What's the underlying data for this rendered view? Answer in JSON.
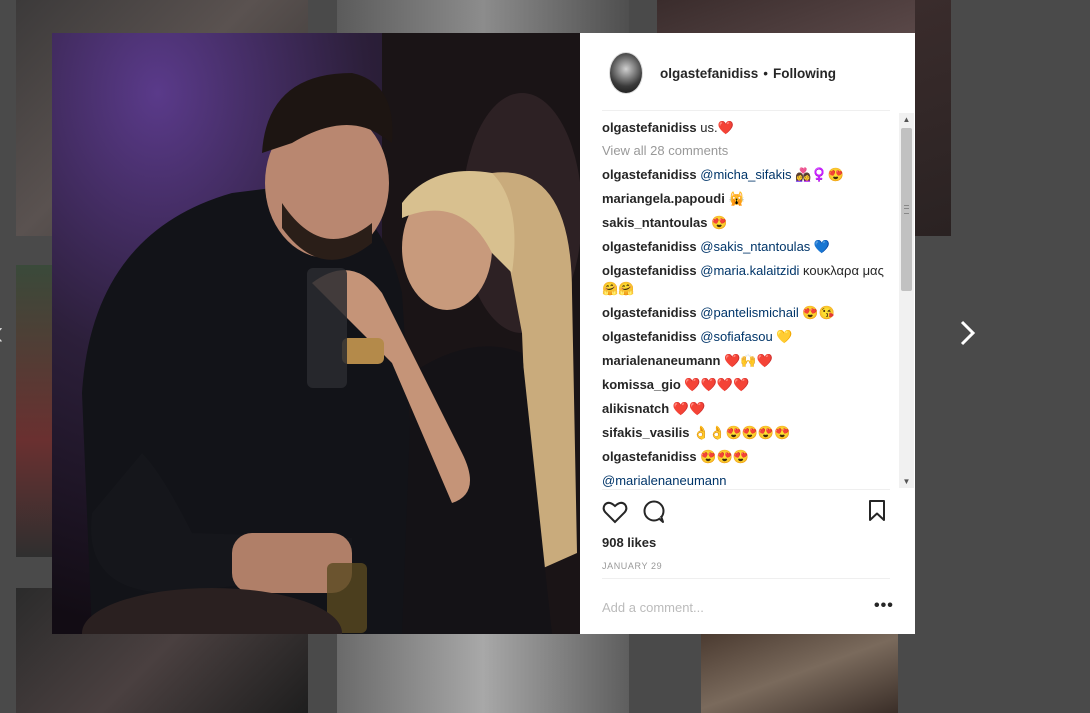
{
  "post": {
    "username": "olgastefanidiss",
    "separator": "•",
    "follow_status": "Following",
    "caption": {
      "user": "olgastefanidiss",
      "text": "us.❤️"
    },
    "view_all": "View all 28 comments",
    "likes": "908 likes",
    "date": "JANUARY 29",
    "add_comment_placeholder": "Add a comment...",
    "more_label": "•••"
  },
  "comments": [
    {
      "user": "olgastefanidiss",
      "mention": "@micha_sifakis",
      "text": " 👩‍❤️‍👩♀️😍"
    },
    {
      "user": "mariangela.papoudi",
      "mention": "",
      "text": " 🙀"
    },
    {
      "user": "sakis_ntantoulas",
      "mention": "",
      "text": " 😍"
    },
    {
      "user": "olgastefanidiss",
      "mention": "@sakis_ntantoulas",
      "text": " 💙"
    },
    {
      "user": "olgastefanidiss",
      "mention": "@maria.kalaitzidi",
      "text": " κουκλαρα μας🤗🤗"
    },
    {
      "user": "olgastefanidiss",
      "mention": "@pantelismichail",
      "text": " 😍😘"
    },
    {
      "user": "olgastefanidiss",
      "mention": "@sofiafasou",
      "text": " 💛"
    },
    {
      "user": "marialenaneumann",
      "mention": "",
      "text": " ❤️🙌❤️"
    },
    {
      "user": "komissa_gio",
      "mention": "",
      "text": " ❤️❤️❤️❤️"
    },
    {
      "user": "alikisnatch",
      "mention": "",
      "text": " ❤️❤️"
    },
    {
      "user": "sifakis_vasilis",
      "mention": "",
      "text": " 👌👌😍😍😍😍"
    },
    {
      "user": "olgastefanidiss",
      "mention": "",
      "text": " 😍😍😍"
    },
    {
      "user": "",
      "mention": "@marialenaneumann",
      "text": ""
    }
  ],
  "icons": {
    "nav_prev": "chevron-left",
    "nav_next": "chevron-right",
    "like": "heart-outline",
    "comment": "speech-bubble",
    "save": "bookmark-outline"
  },
  "colors": {
    "text": "#262626",
    "mention": "#003569",
    "muted": "#999999",
    "backdrop": "#4a4a4a"
  }
}
